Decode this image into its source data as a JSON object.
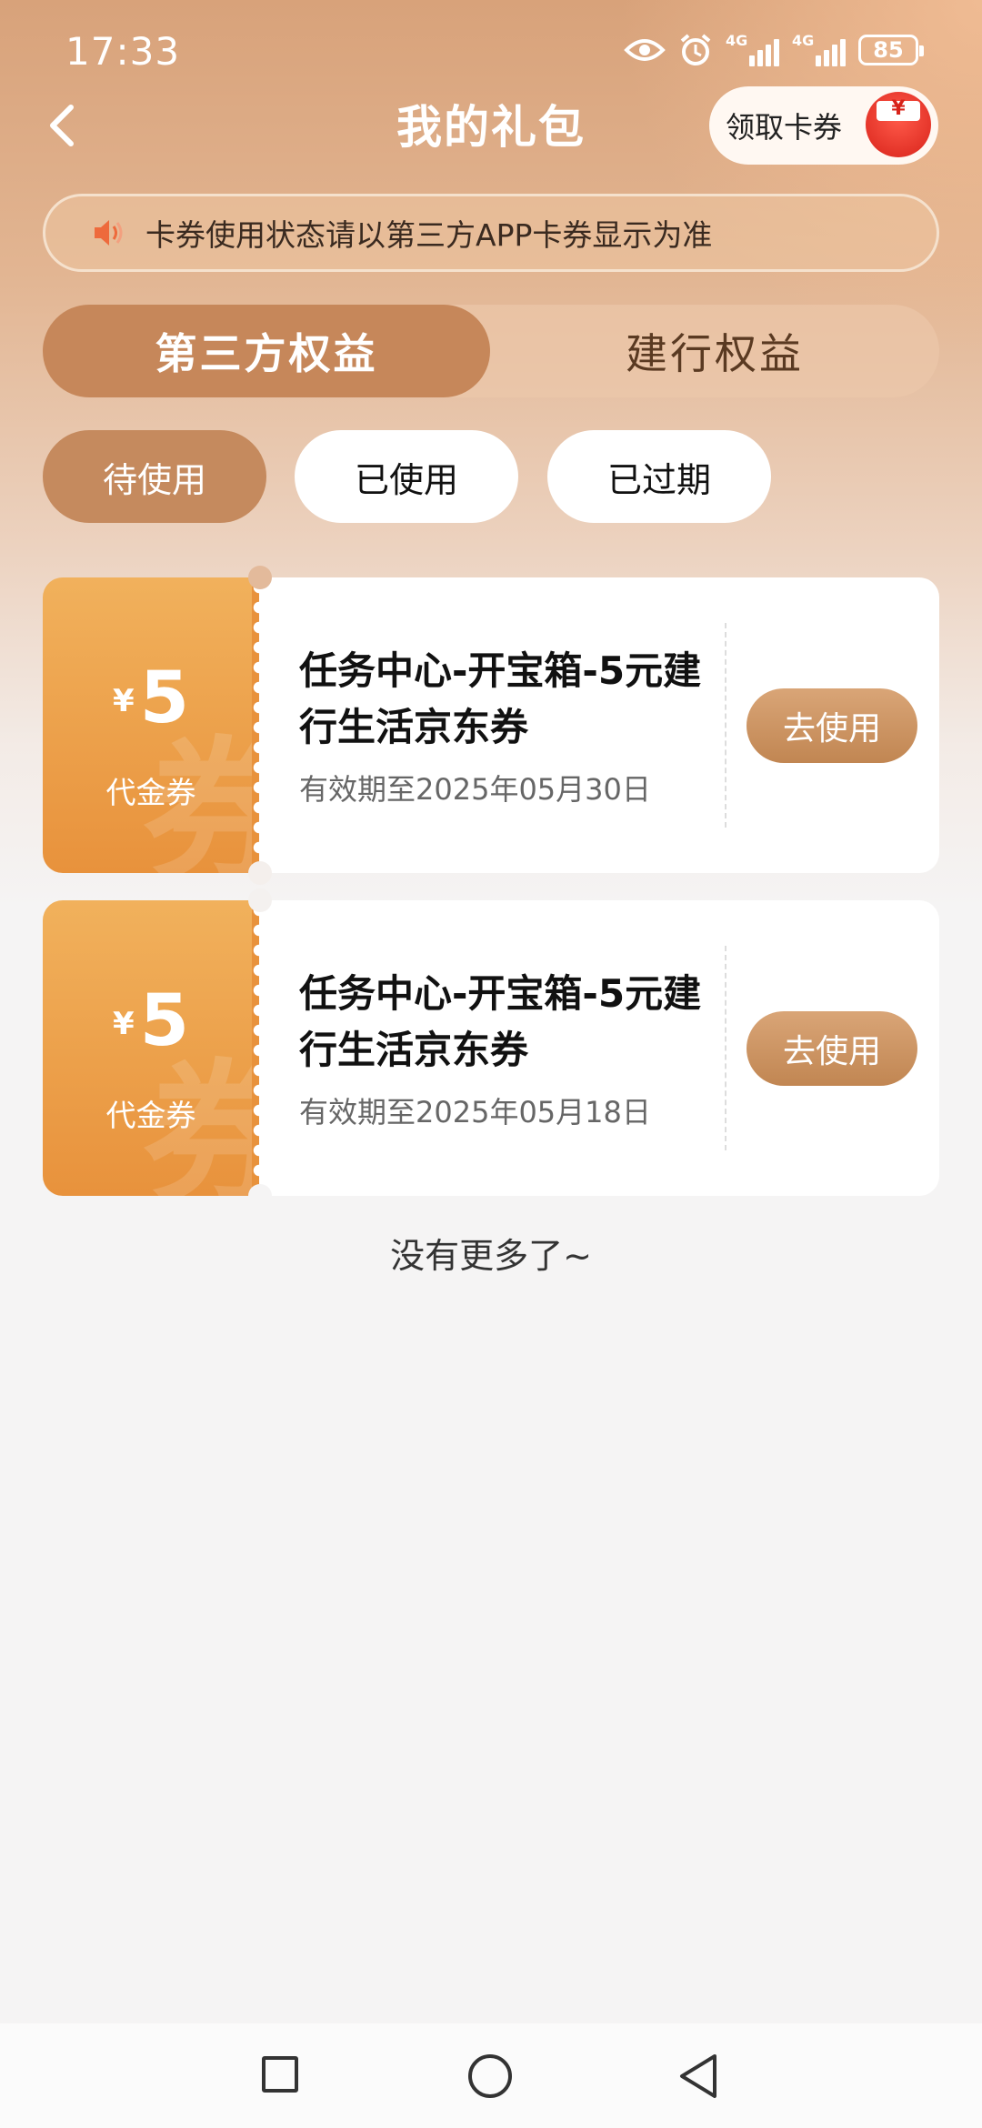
{
  "status_bar": {
    "time": "17:33",
    "net1": "4G",
    "net2": "4G",
    "battery": "85"
  },
  "header": {
    "title": "我的礼包",
    "get_coupon_label": "领取卡券",
    "gift_symbol": "¥"
  },
  "notice": {
    "text": "卡券使用状态请以第三方APP卡券显示为准"
  },
  "main_tabs": [
    {
      "label": "第三方权益",
      "active": true
    },
    {
      "label": "建行权益",
      "active": false
    }
  ],
  "filters": [
    {
      "label": "待使用",
      "active": true
    },
    {
      "label": "已使用",
      "active": false
    },
    {
      "label": "已过期",
      "active": false
    }
  ],
  "coupons": [
    {
      "currency": "¥",
      "amount": "5",
      "kind": "代金券",
      "watermark": "券",
      "title": "任务中心-开宝箱-5元建行生活京东券",
      "expiry": "有效期至2025年05月30日",
      "action": "去使用"
    },
    {
      "currency": "¥",
      "amount": "5",
      "kind": "代金券",
      "watermark": "券",
      "title": "任务中心-开宝箱-5元建行生活京东券",
      "expiry": "有效期至2025年05月18日",
      "action": "去使用"
    }
  ],
  "footer": {
    "no_more": "没有更多了~"
  },
  "colors": {
    "accent": "#c6875a",
    "coupon_orange": "#e8923c"
  }
}
